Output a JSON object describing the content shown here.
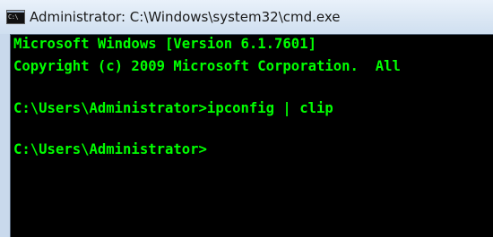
{
  "window": {
    "title": "Administrator: C:\\Windows\\system32\\cmd.exe",
    "icon": "cmd-icon",
    "icon_glyph": "C:\\"
  },
  "console": {
    "text_color": "#00ff00",
    "background": "#000000",
    "lines": [
      "Microsoft Windows [Version 6.1.7601]",
      "Copyright (c) 2009 Microsoft Corporation.  All",
      "C:\\Users\\Administrator>ipconfig | clip",
      "C:\\Users\\Administrator>"
    ]
  }
}
